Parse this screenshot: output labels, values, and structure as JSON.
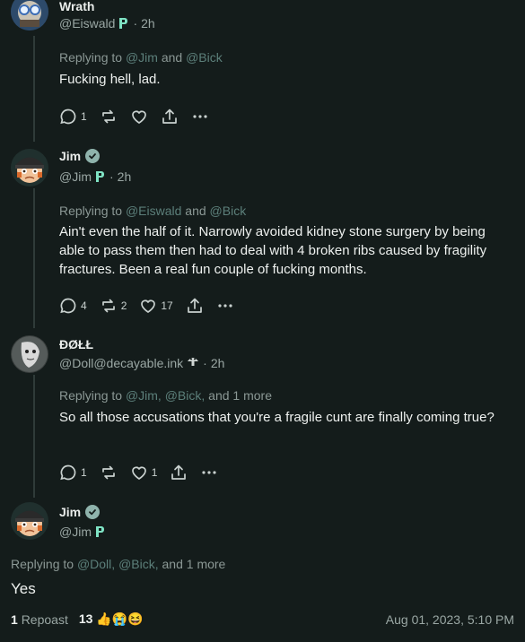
{
  "posts": [
    {
      "name": "Wrath",
      "handle": "@Eiswald",
      "time": "2h",
      "replying_prefix": "Replying to",
      "replying_to": [
        "@Jim",
        "@Bick"
      ],
      "replying_join": "and",
      "text": "Fucking hell, lad.",
      "reply_count": "1",
      "boost_count": "",
      "like_count": ""
    },
    {
      "name": "Jim",
      "handle": "@Jim",
      "time": "2h",
      "replying_prefix": "Replying to",
      "replying_to": [
        "@Eiswald",
        "@Bick"
      ],
      "replying_join": "and",
      "text": "Ain't even the half of it.  Narrowly avoided kidney stone surgery by being able to pass them then had to deal with 4 broken ribs caused by fragility fractures.  Been a real fun couple of fucking months.",
      "reply_count": "4",
      "boost_count": "2",
      "like_count": "17"
    },
    {
      "name": "ÐØŁŁ",
      "handle": "@Doll@decayable.ink",
      "time": "2h",
      "replying_prefix": "Replying to",
      "replying_to": [
        "@Jim",
        "@Bick"
      ],
      "replying_more": "and 1 more",
      "text": "So all those accusations that you're a fragile cunt are finally coming true?",
      "reply_count": "1",
      "boost_count": "",
      "like_count": "1"
    }
  ],
  "main_post": {
    "name": "Jim",
    "handle": "@Jim",
    "replying_prefix": "Replying to",
    "replying_to": [
      "@Doll",
      "@Bick"
    ],
    "replying_more": "and 1 more",
    "text": "Yes",
    "repost_count": "1",
    "repost_label": "Repoast",
    "reaction_count": "13",
    "reactions": "👍😭😆",
    "date": "Aug 01, 2023, 5:10 PM"
  },
  "colors": {
    "background": "#141c1b",
    "mention": "#5c7f7a",
    "muted": "#9aa7a4",
    "verified": "#8fb3ac",
    "p_badge": "#7fe3c4"
  },
  "icons": [
    "reply-icon",
    "boost-icon",
    "like-icon",
    "share-icon",
    "more-icon",
    "verified-icon",
    "instance-badge-icon",
    "mushroom-icon"
  ]
}
